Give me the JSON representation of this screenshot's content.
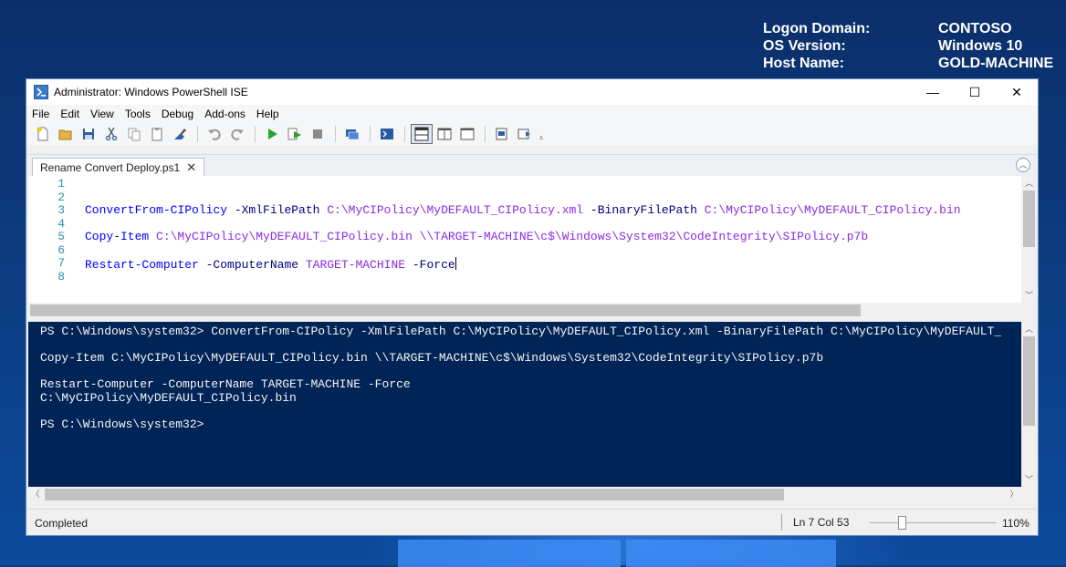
{
  "bginfo": {
    "rows": [
      {
        "key": "Logon Domain:",
        "value": "CONTOSO"
      },
      {
        "key": "OS Version:",
        "value": "Windows 10"
      },
      {
        "key": "Host Name:",
        "value": "GOLD-MACHINE"
      }
    ]
  },
  "window": {
    "title": "Administrator: Windows PowerShell ISE",
    "controls": {
      "minimize": "—",
      "maximize": "☐",
      "close": "✕"
    }
  },
  "menu": [
    "File",
    "Edit",
    "View",
    "Tools",
    "Debug",
    "Add-ons",
    "Help"
  ],
  "toolbar_icons": [
    "new-file-icon",
    "open-folder-icon",
    "save-icon",
    "cut-icon",
    "copy-icon",
    "paste-icon",
    "clear-icon",
    "undo-icon",
    "redo-icon",
    "run-icon",
    "run-selection-icon",
    "stop-icon",
    "remote-powershell-icon",
    "powershell-console-icon",
    "script-pane-top-icon",
    "script-pane-right-icon",
    "script-pane-maximized-icon",
    "show-command-window-icon",
    "show-command-addon-icon",
    "toolbar-overflow-icon"
  ],
  "tab": {
    "label": "Rename Convert Deploy.ps1",
    "close": "✕"
  },
  "editor": {
    "line_numbers": [
      "1",
      "2",
      "3",
      "4",
      "5",
      "6",
      "7",
      "8"
    ],
    "lines": [
      [],
      [],
      [
        {
          "t": "ConvertFrom-CIPolicy",
          "c": "cmd"
        },
        {
          "t": " -XmlFilePath",
          "c": "param"
        },
        {
          "t": " C:\\MyCIPolicy\\MyDEFAULT_CIPolicy.xml",
          "c": "arg"
        },
        {
          "t": " -BinaryFilePath",
          "c": "param"
        },
        {
          "t": " C:\\MyCIPolicy\\MyDEFAULT_CIPolicy.bin",
          "c": "arg"
        }
      ],
      [],
      [
        {
          "t": "Copy-Item",
          "c": "cmd"
        },
        {
          "t": " C:\\MyCIPolicy\\MyDEFAULT_CIPolicy.bin",
          "c": "arg"
        },
        {
          "t": " \\\\TARGET-MACHINE\\c$\\Windows\\System32\\CodeIntegrity\\SIPolicy.p7b",
          "c": "arg"
        }
      ],
      [],
      [
        {
          "t": "Restart-Computer",
          "c": "cmd"
        },
        {
          "t": " -ComputerName",
          "c": "param"
        },
        {
          "t": " TARGET-MACHINE",
          "c": "arg"
        },
        {
          "t": " -Force",
          "c": "param"
        }
      ],
      []
    ]
  },
  "console": {
    "lines": [
      "PS C:\\Windows\\system32> ConvertFrom-CIPolicy -XmlFilePath C:\\MyCIPolicy\\MyDEFAULT_CIPolicy.xml -BinaryFilePath C:\\MyCIPolicy\\MyDEFAULT_",
      "",
      "Copy-Item C:\\MyCIPolicy\\MyDEFAULT_CIPolicy.bin \\\\TARGET-MACHINE\\c$\\Windows\\System32\\CodeIntegrity\\SIPolicy.p7b",
      "",
      "Restart-Computer -ComputerName TARGET-MACHINE -Force",
      "C:\\MyCIPolicy\\MyDEFAULT_CIPolicy.bin",
      "",
      "PS C:\\Windows\\system32>"
    ]
  },
  "status": {
    "text": "Completed",
    "position": "Ln 7  Col 53",
    "zoom": "110%",
    "zoom_level": 0.25
  },
  "colors": {
    "console_bg": "#012456",
    "cmdlet": "#0000ff",
    "parameter": "#000080",
    "argument": "#8a2be2",
    "line_number": "#2b91af"
  }
}
